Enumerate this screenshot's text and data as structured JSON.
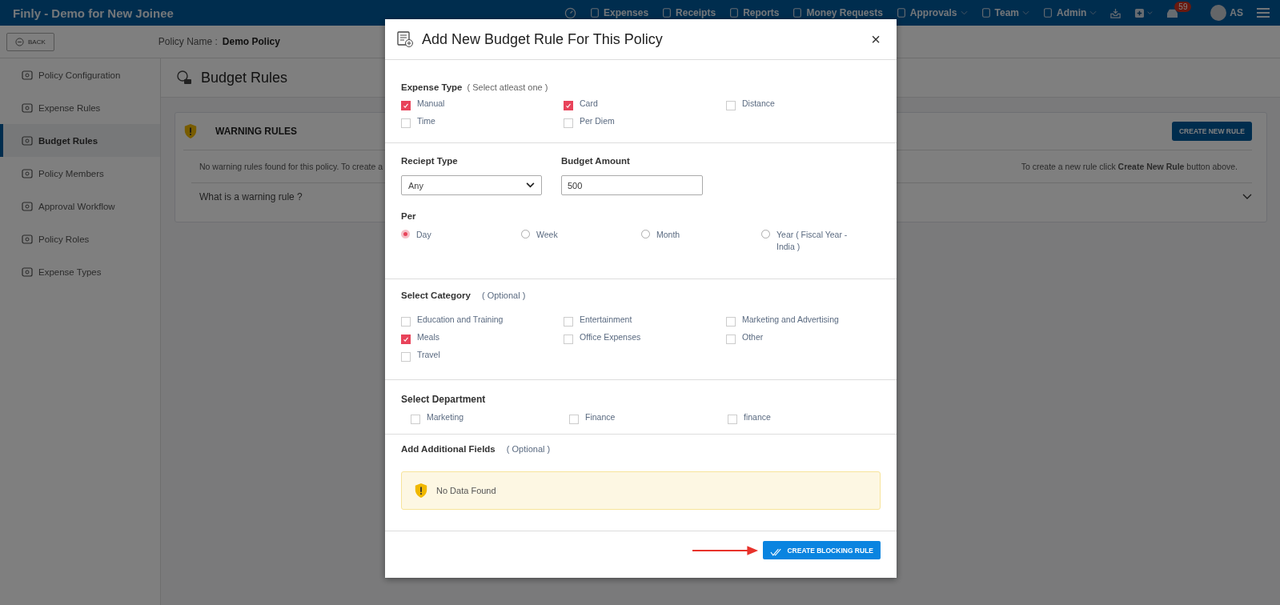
{
  "app": {
    "title": "Finly - Demo for New Joinee"
  },
  "topnav": [
    {
      "label": "Expenses",
      "dropdown": false
    },
    {
      "label": "Receipts",
      "dropdown": false
    },
    {
      "label": "Reports",
      "dropdown": false
    },
    {
      "label": "Money Requests",
      "dropdown": false
    },
    {
      "label": "Approvals",
      "dropdown": true
    },
    {
      "label": "Team",
      "dropdown": true
    },
    {
      "label": "Admin",
      "dropdown": true
    }
  ],
  "notification_badge": "59",
  "user_initials": "AS",
  "subheader": {
    "back": "BACK",
    "policy_label": "Policy Name :",
    "policy_name": "Demo Policy"
  },
  "sidebar": [
    {
      "label": "Policy Configuration",
      "selected": false
    },
    {
      "label": "Expense Rules",
      "selected": false
    },
    {
      "label": "Budget Rules",
      "selected": true
    },
    {
      "label": "Policy Members",
      "selected": false
    },
    {
      "label": "Approval Workflow",
      "selected": false
    },
    {
      "label": "Policy Roles",
      "selected": false
    },
    {
      "label": "Expense Types",
      "selected": false
    }
  ],
  "page_title": "Budget Rules",
  "warning_card": {
    "title": "WARNING RULES",
    "button": "CREATE NEW RULE",
    "message_left": "No warning rules found for this policy. To create a",
    "message_right": "To create a new rule click **Create New Rule** button above.",
    "faq": "What is a warning rule ?",
    "expanded": false
  },
  "modal": {
    "title": "Add New Budget Rule For This Policy",
    "close": "×",
    "expense_type": {
      "label": "Expense Type",
      "hint": "( Select atleast one )",
      "options": [
        {
          "label": "Manual",
          "checked": true
        },
        {
          "label": "Card",
          "checked": true
        },
        {
          "label": "Distance",
          "checked": false
        },
        {
          "label": "Time",
          "checked": false
        },
        {
          "label": "Per Diem",
          "checked": false
        }
      ]
    },
    "receipt_type": {
      "label": "Reciept Type",
      "value": "Any"
    },
    "budget_amount": {
      "label": "Budget Amount",
      "value": "500"
    },
    "per": {
      "label": "Per",
      "options": [
        {
          "label": "Day",
          "selected": true
        },
        {
          "label": "Week",
          "selected": false
        },
        {
          "label": "Month",
          "selected": false
        },
        {
          "label": "Year ( Fiscal Year - India )",
          "selected": false
        }
      ]
    },
    "category": {
      "label": "Select Category",
      "hint": "( Optional )",
      "options": [
        {
          "label": "Education and Training",
          "checked": false
        },
        {
          "label": "Entertainment",
          "checked": false
        },
        {
          "label": "Marketing and Advertising",
          "checked": false
        },
        {
          "label": "Meals",
          "checked": true
        },
        {
          "label": "Office Expenses",
          "checked": false
        },
        {
          "label": "Other",
          "checked": false
        },
        {
          "label": "Travel",
          "checked": false
        }
      ]
    },
    "department": {
      "label": "Select Department",
      "options": [
        {
          "label": "Marketing",
          "checked": false
        },
        {
          "label": "Finance",
          "checked": false
        },
        {
          "label": "finance",
          "checked": false
        }
      ]
    },
    "additional_fields": {
      "label": "Add Additional Fields",
      "hint": "( Optional )",
      "empty_message": "No Data Found"
    },
    "submit": "CREATE BLOCKING RULE"
  }
}
